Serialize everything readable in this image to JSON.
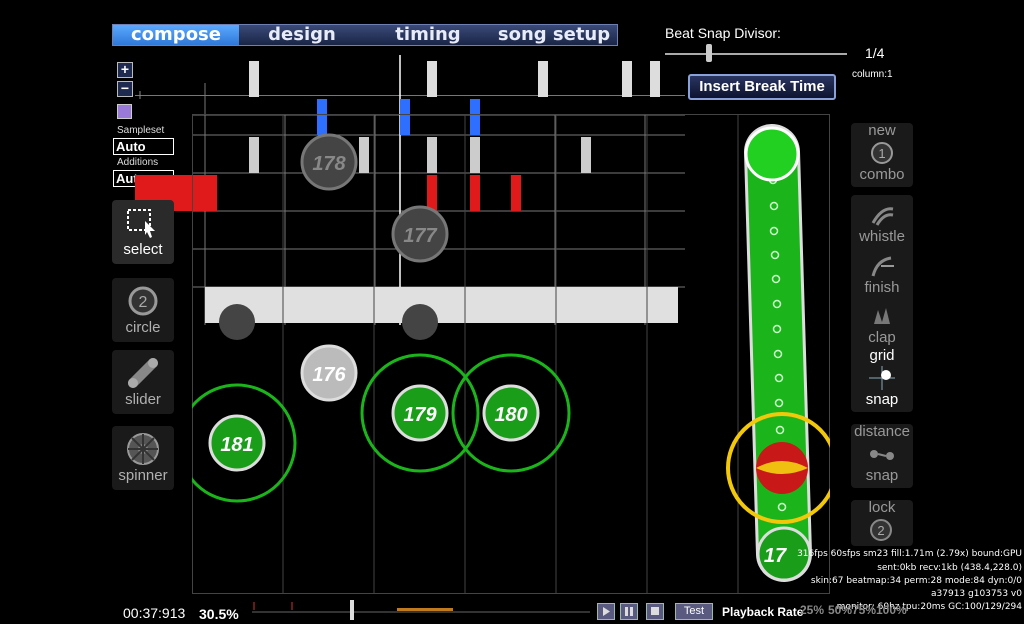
{
  "tabs": [
    {
      "label": "compose",
      "active": true
    },
    {
      "label": "design",
      "active": false
    },
    {
      "label": "timing",
      "active": false
    },
    {
      "label": "song setup",
      "active": false
    }
  ],
  "beat_snap": {
    "label": "Beat Snap Divisor:",
    "value": "1/4",
    "column": "column:1"
  },
  "insert_break_label": "Insert Break Time",
  "zoom": {
    "in": "+",
    "out": "−"
  },
  "sampleset": {
    "label": "Sampleset",
    "value": "Auto"
  },
  "additions": {
    "label": "Additions",
    "value": "Auto"
  },
  "left_tools": [
    {
      "label": "select",
      "icon": "select-icon"
    },
    {
      "label": "circle",
      "icon": "circle-icon"
    },
    {
      "label": "slider",
      "icon": "slider-icon"
    },
    {
      "label": "spinner",
      "icon": "spinner-icon"
    }
  ],
  "right_tools": [
    {
      "line1": "new",
      "line2": "combo",
      "icon": "new-combo-icon",
      "on": false
    },
    {
      "line1": "",
      "line2": "whistle",
      "icon": "whistle-icon",
      "on": false
    },
    {
      "line1": "",
      "line2": "finish",
      "icon": "finish-icon",
      "on": false
    },
    {
      "line1": "",
      "line2": "clap",
      "icon": "clap-icon",
      "on": false
    },
    {
      "line1": "grid",
      "line2": "snap",
      "icon": "grid-snap-icon",
      "on": true
    },
    {
      "line1": "distance",
      "line2": "snap",
      "icon": "distance-snap-icon",
      "on": false
    },
    {
      "line1": "lock",
      "line2": "",
      "icon": "lock-icon",
      "on": false
    }
  ],
  "hit_objects": {
    "faded": [
      "178",
      "177",
      "176"
    ],
    "active": [
      "181",
      "179",
      "180"
    ],
    "slider_end": "17"
  },
  "stats": [
    "316fps 60sfps sm23 fill:1.71m (2.79x) bound:GPU",
    "sent:0kb recv:1kb (438.4,228.0)",
    "skin:67 beatmap:34 perm:28 mode:84 dyn:0/0",
    "a37913 g103753 v0",
    "monitor: 60hz tpu:20ms GC:100/129/294"
  ],
  "bottom": {
    "time": "00:37:913",
    "percent": "30.5%",
    "test": "Test",
    "playback_rate_label": "Playback Rate",
    "rates": [
      "25%",
      "50%",
      "75%",
      "100%"
    ]
  },
  "colors": {
    "accent": "#2f78d8",
    "combo": "#1bb51b",
    "whistle": "#2f6fff",
    "finish": "#e01a1a"
  }
}
